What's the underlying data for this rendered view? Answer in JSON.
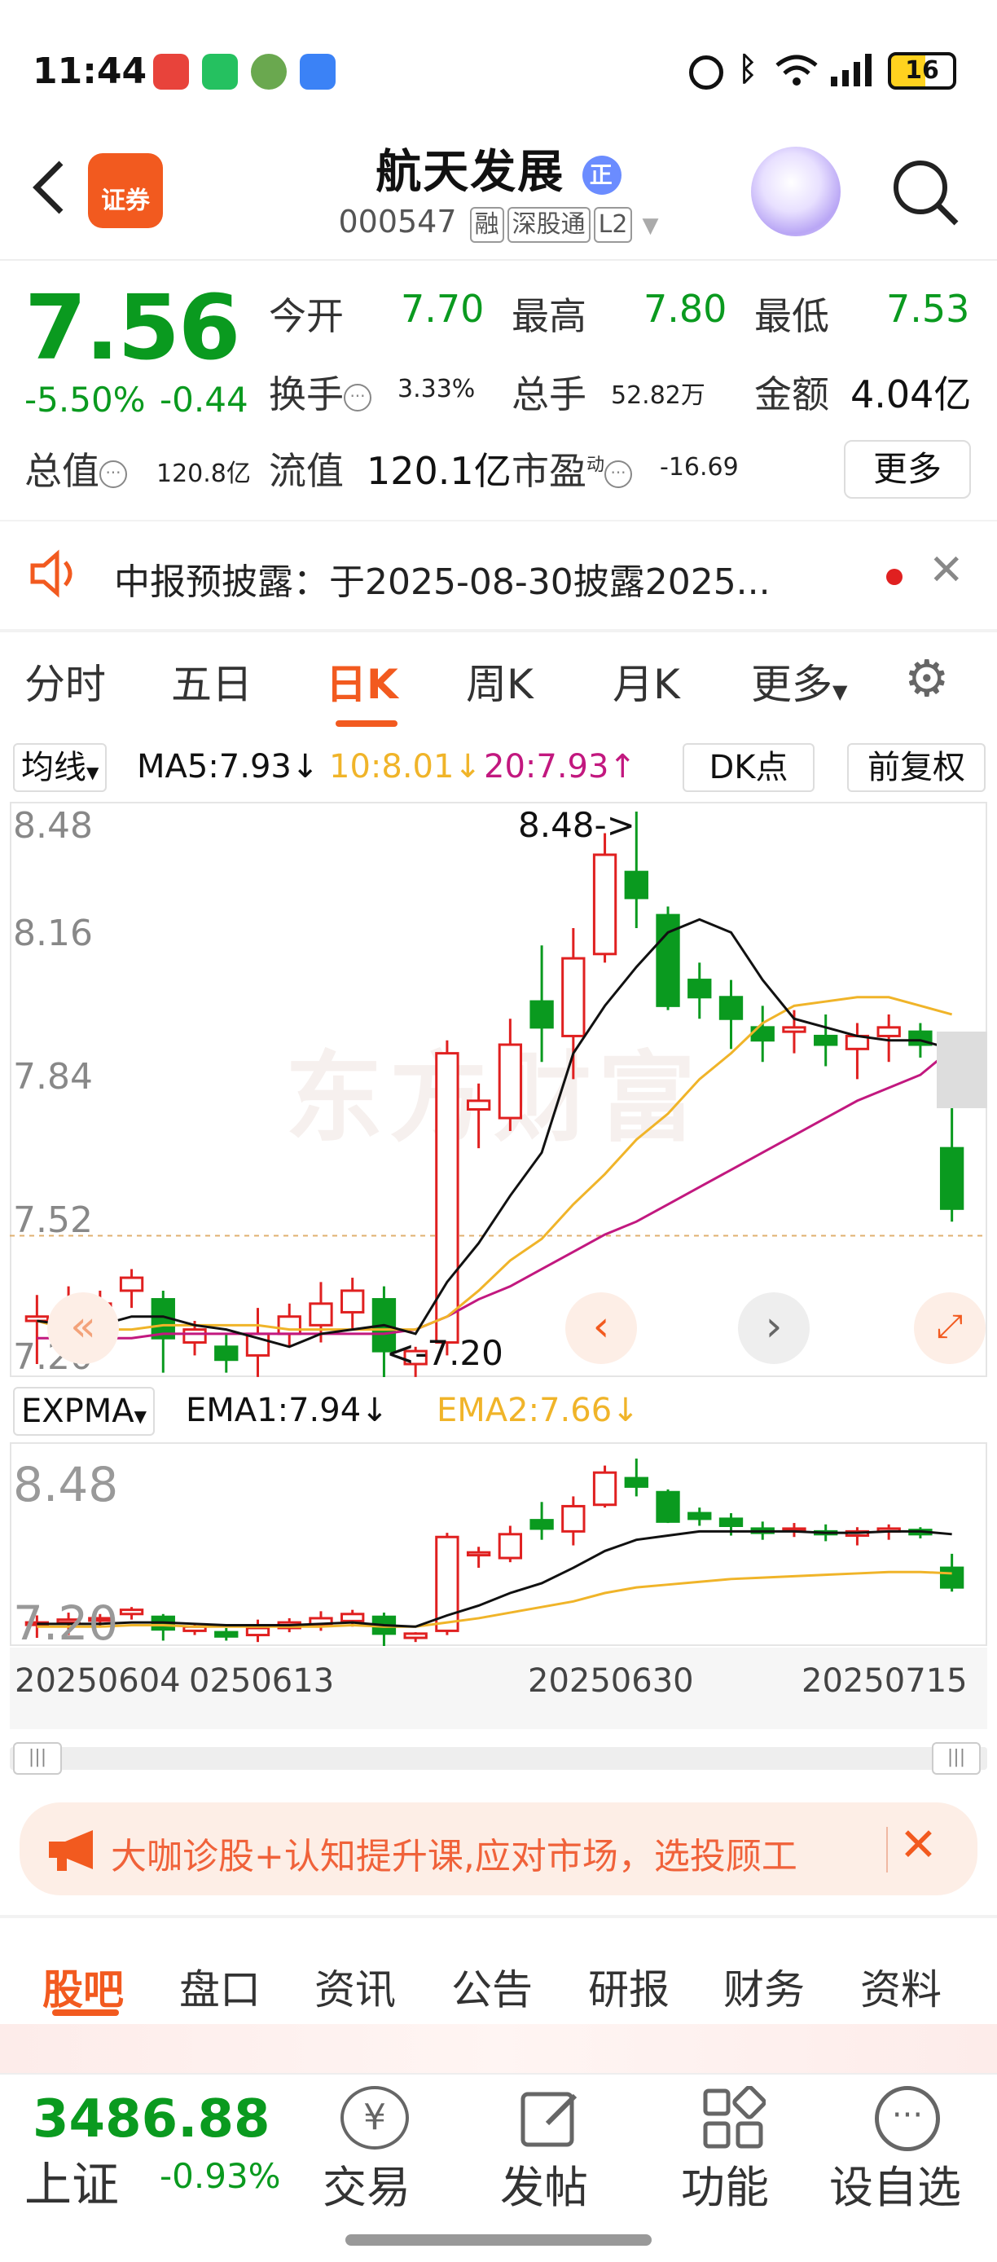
{
  "status": {
    "time": "11:44",
    "battery": "16"
  },
  "header": {
    "back_label": "<",
    "badge": "证券",
    "title": "航天发展",
    "title_badge": "正",
    "code": "000547",
    "tags": [
      "融",
      "深股通",
      "L2"
    ]
  },
  "quote": {
    "price": "7.56",
    "pct": "-5.50%",
    "chg": "-0.44",
    "open_label": "今开",
    "open": "7.70",
    "high_label": "最高",
    "high": "7.80",
    "low_label": "最低",
    "low": "7.53",
    "turnover_label": "换手",
    "turnover": "3.33%",
    "volume_label": "总手",
    "volume": "52.82万",
    "amount_label": "金额",
    "amount": "4.04亿",
    "mcap_label": "总值",
    "mcap": "120.8亿",
    "float_label": "流值",
    "float": "120.1亿",
    "pe_label": "市盈",
    "pe_sup": "动",
    "pe": "-16.69",
    "more": "更多"
  },
  "notice": {
    "text": "中报预披露：于2025-08-30披露2025..."
  },
  "tabs": [
    "分时",
    "五日",
    "日K",
    "周K",
    "月K",
    "更多",
    "⚙"
  ],
  "ma": {
    "selector": "均线",
    "ma5": "MA5:7.93↓",
    "ma10": "10:8.01↓",
    "ma20": "20:7.93↑",
    "dk": "DK点",
    "fq": "前复权"
  },
  "chart_data": [
    {
      "type": "candlestick",
      "title": "日K",
      "ylabels": [
        "8.48",
        "8.16",
        "7.84",
        "7.52",
        "7.20"
      ],
      "high_mark": "8.48->",
      "low_mark": "<-7.20",
      "watermark": "东方财富",
      "candles": [
        [
          7.3,
          7.31,
          7.2,
          7.36
        ],
        [
          7.31,
          7.33,
          7.22,
          7.38
        ],
        [
          7.34,
          7.34,
          7.28,
          7.37
        ],
        [
          7.37,
          7.4,
          7.33,
          7.42
        ],
        [
          7.35,
          7.26,
          7.18,
          7.37
        ],
        [
          7.25,
          7.28,
          7.22,
          7.3
        ],
        [
          7.24,
          7.21,
          7.18,
          7.27
        ],
        [
          7.22,
          7.27,
          7.17,
          7.33
        ],
        [
          7.27,
          7.31,
          7.24,
          7.34
        ],
        [
          7.29,
          7.34,
          7.25,
          7.39
        ],
        [
          7.32,
          7.37,
          7.28,
          7.4
        ],
        [
          7.35,
          7.23,
          7.14,
          7.38
        ],
        [
          7.2,
          7.23,
          7.17,
          7.24
        ],
        [
          7.25,
          7.92,
          7.22,
          7.95
        ],
        [
          7.79,
          7.81,
          7.7,
          7.85
        ],
        [
          7.77,
          7.94,
          7.74,
          8.0
        ],
        [
          8.04,
          7.98,
          7.9,
          8.17
        ],
        [
          7.96,
          8.14,
          7.86,
          8.21
        ],
        [
          8.15,
          8.38,
          8.13,
          8.43
        ],
        [
          8.34,
          8.28,
          8.21,
          8.48
        ],
        [
          8.24,
          8.03,
          8.02,
          8.26
        ],
        [
          8.09,
          8.05,
          8.0,
          8.13
        ],
        [
          8.05,
          8.0,
          7.93,
          8.09
        ],
        [
          7.98,
          7.95,
          7.9,
          8.03
        ],
        [
          7.97,
          7.98,
          7.92,
          8.02
        ],
        [
          7.96,
          7.94,
          7.89,
          8.01
        ],
        [
          7.93,
          7.96,
          7.86,
          7.99
        ],
        [
          7.96,
          7.98,
          7.9,
          8.01
        ],
        [
          7.97,
          7.94,
          7.91,
          7.99
        ],
        [
          7.7,
          7.56,
          7.53,
          7.8
        ]
      ],
      "ma5": [
        7.3,
        7.29,
        7.29,
        7.31,
        7.31,
        7.29,
        7.28,
        7.26,
        7.24,
        7.27,
        7.28,
        7.29,
        7.27,
        7.39,
        7.48,
        7.59,
        7.69,
        7.92,
        8.03,
        8.12,
        8.2,
        8.23,
        8.2,
        8.09,
        8.0,
        7.98,
        7.96,
        7.95,
        7.95,
        7.93
      ],
      "ma10": [
        7.3,
        7.28,
        7.28,
        7.28,
        7.29,
        7.29,
        7.29,
        7.29,
        7.28,
        7.28,
        7.28,
        7.28,
        7.28,
        7.31,
        7.37,
        7.44,
        7.49,
        7.57,
        7.64,
        7.72,
        7.78,
        7.86,
        7.92,
        7.99,
        8.03,
        8.04,
        8.05,
        8.05,
        8.03,
        8.01
      ],
      "ma20": [
        7.26,
        7.26,
        7.26,
        7.26,
        7.27,
        7.27,
        7.27,
        7.27,
        7.27,
        7.27,
        7.27,
        7.27,
        7.28,
        7.31,
        7.35,
        7.38,
        7.42,
        7.46,
        7.5,
        7.53,
        7.57,
        7.61,
        7.65,
        7.69,
        7.73,
        7.77,
        7.81,
        7.84,
        7.87,
        7.93
      ],
      "ylim": [
        7.2,
        8.48
      ]
    },
    {
      "type": "line",
      "title": "EXPMA",
      "ylabels": [
        "8.48",
        "7.20"
      ],
      "x_labels": [
        "20250604",
        "0250613",
        "20250630",
        "20250715"
      ],
      "ema1": [
        7.3,
        7.3,
        7.3,
        7.31,
        7.31,
        7.3,
        7.29,
        7.29,
        7.29,
        7.3,
        7.31,
        7.29,
        7.28,
        7.36,
        7.43,
        7.52,
        7.59,
        7.7,
        7.82,
        7.9,
        7.93,
        7.96,
        7.96,
        7.96,
        7.96,
        7.95,
        7.95,
        7.96,
        7.96,
        7.94
      ],
      "ema2": [
        7.28,
        7.28,
        7.28,
        7.29,
        7.29,
        7.28,
        7.28,
        7.28,
        7.28,
        7.28,
        7.29,
        7.28,
        7.28,
        7.31,
        7.34,
        7.38,
        7.42,
        7.46,
        7.52,
        7.56,
        7.58,
        7.6,
        7.62,
        7.63,
        7.64,
        7.65,
        7.66,
        7.67,
        7.67,
        7.66
      ]
    }
  ],
  "expma": {
    "selector": "EXPMA",
    "ema1": "EMA1:7.94↓",
    "ema2": "EMA2:7.66↓"
  },
  "promo": {
    "text": "大咖诊股+认知提升课,应对市场，选投顾工"
  },
  "subtabs": [
    "股吧",
    "盘口",
    "资讯",
    "公告",
    "研报",
    "财务",
    "资料"
  ],
  "footer": {
    "index_value": "3486.88",
    "index_name": "上证",
    "index_pct": "-0.93%",
    "items": [
      "交易",
      "发帖",
      "功能",
      "设自选"
    ]
  },
  "colors": {
    "up": "#e02020",
    "down": "#0a9a1f",
    "accent": "#f25a1f",
    "ma5": "#111111",
    "ma10": "#f0b429",
    "ma20": "#c2187f"
  }
}
